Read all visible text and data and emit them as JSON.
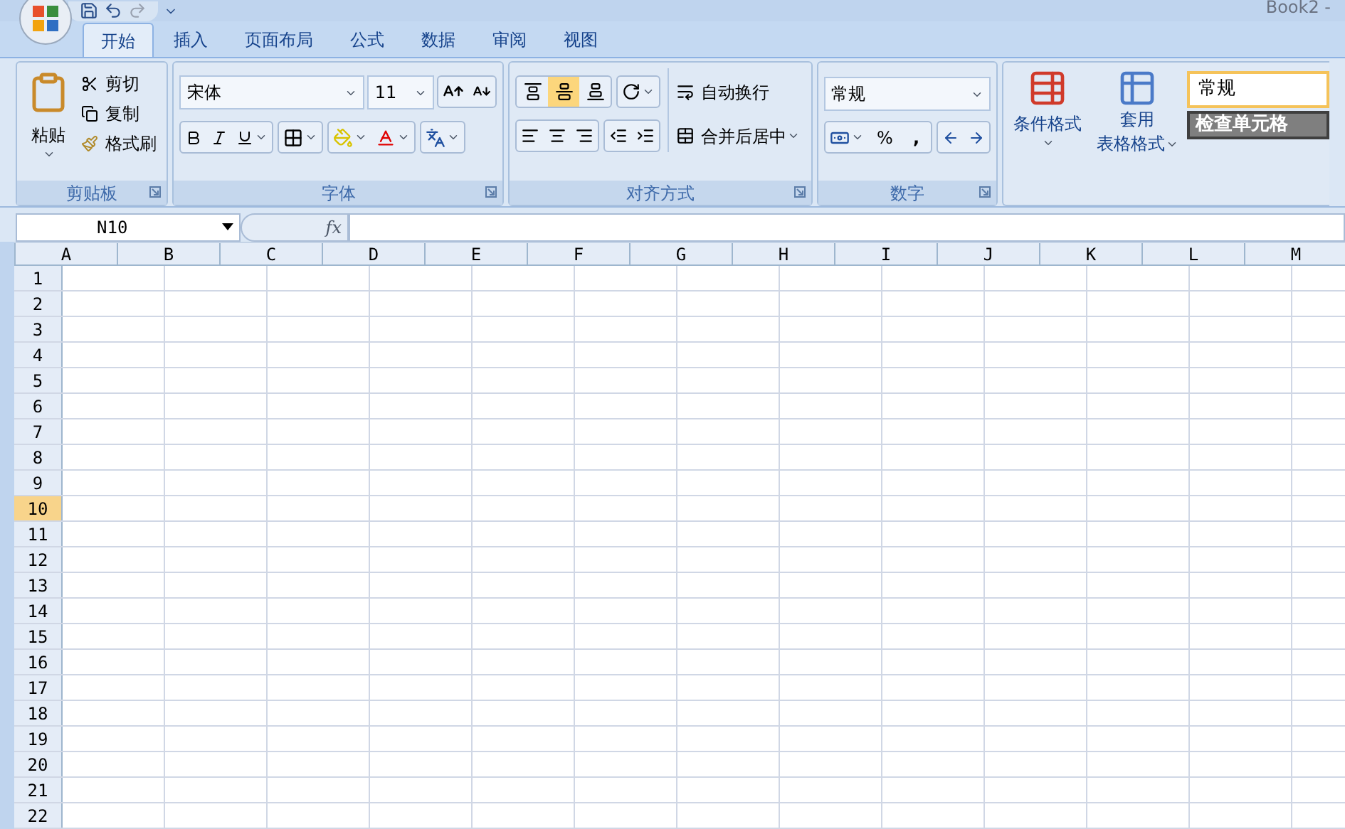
{
  "title": "Book2 - ",
  "tabs": [
    {
      "label": "开始",
      "selected": true
    },
    {
      "label": "插入",
      "selected": false
    },
    {
      "label": "页面布局",
      "selected": false
    },
    {
      "label": "公式",
      "selected": false
    },
    {
      "label": "数据",
      "selected": false
    },
    {
      "label": "审阅",
      "selected": false
    },
    {
      "label": "视图",
      "selected": false
    }
  ],
  "clipboard": {
    "paste": "粘贴",
    "items": [
      "剪切",
      "复制",
      "格式刷"
    ],
    "label": "剪贴板"
  },
  "font": {
    "name": "宋体",
    "size": "11",
    "label": "字体"
  },
  "alignment": {
    "vertical": [
      {
        "kind": "top",
        "selected": false
      },
      {
        "kind": "middle",
        "selected": true
      },
      {
        "kind": "bottom",
        "selected": false
      }
    ],
    "wrap": "自动换行",
    "merge": "合并后居中",
    "label": "对齐方式"
  },
  "number": {
    "format": "常规",
    "percent": "%",
    "comma": ",",
    "label": "数字"
  },
  "styles": {
    "conditional": "条件格式",
    "table_line1": "套用",
    "table_line2": "表格格式",
    "normal": "常规",
    "check": "检查单元格"
  },
  "name_box": "N10",
  "formula_icon": "fx",
  "columns": [
    "A",
    "B",
    "C",
    "D",
    "E",
    "F",
    "G",
    "H",
    "I",
    "J",
    "K",
    "L",
    "M"
  ],
  "rows": [
    {
      "label": "1",
      "selected": false
    },
    {
      "label": "2",
      "selected": false
    },
    {
      "label": "3",
      "selected": false
    },
    {
      "label": "4",
      "selected": false
    },
    {
      "label": "5",
      "selected": false
    },
    {
      "label": "6",
      "selected": false
    },
    {
      "label": "7",
      "selected": false
    },
    {
      "label": "8",
      "selected": false
    },
    {
      "label": "9",
      "selected": false
    },
    {
      "label": "10",
      "selected": true
    },
    {
      "label": "11",
      "selected": false
    },
    {
      "label": "12",
      "selected": false
    },
    {
      "label": "13",
      "selected": false
    },
    {
      "label": "14",
      "selected": false
    },
    {
      "label": "15",
      "selected": false
    },
    {
      "label": "16",
      "selected": false
    },
    {
      "label": "17",
      "selected": false
    },
    {
      "label": "18",
      "selected": false
    },
    {
      "label": "19",
      "selected": false
    },
    {
      "label": "20",
      "selected": false
    },
    {
      "label": "21",
      "selected": false
    },
    {
      "label": "22",
      "selected": false
    }
  ]
}
